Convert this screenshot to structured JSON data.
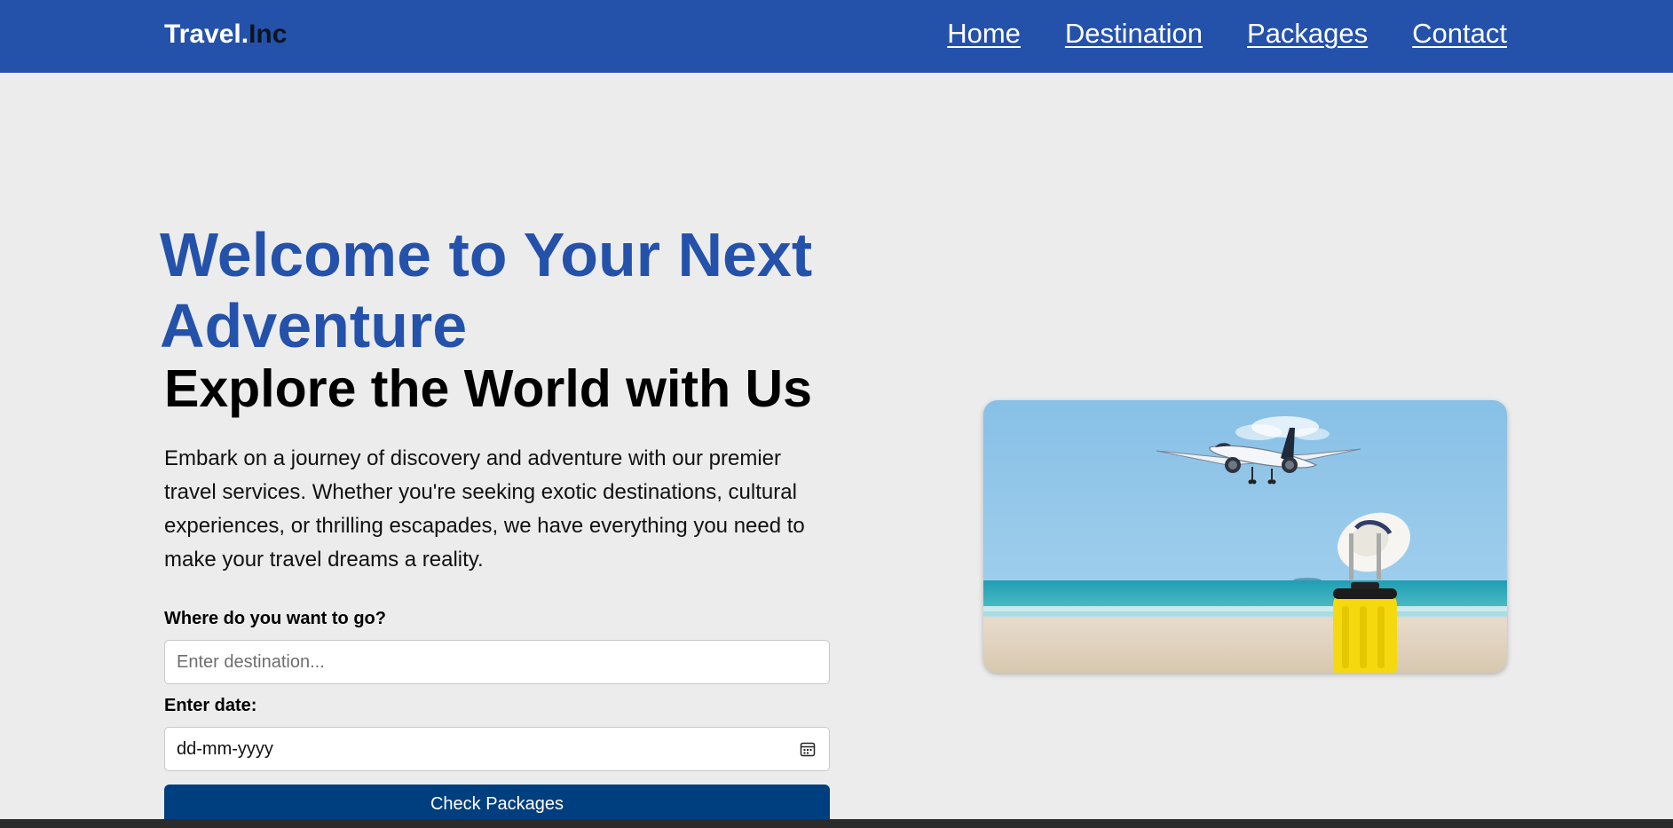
{
  "navbar": {
    "brand_part1": "Travel.",
    "brand_part2": "Inc",
    "links": [
      {
        "label": "Home"
      },
      {
        "label": "Destination"
      },
      {
        "label": "Packages"
      },
      {
        "label": "Contact"
      }
    ],
    "background_color": "#2452ab"
  },
  "hero": {
    "title": "Welcome to Your Next Adventure",
    "subtitle": "Explore the World with Us",
    "description": "Embark on a journey of discovery and adventure with our premier travel services. Whether you're seeking exotic destinations, cultural experiences, or thrilling escapades, we have everything you need to make your travel dreams a reality.",
    "title_color": "#2452ab"
  },
  "form": {
    "destination_label": "Where do you want to go?",
    "destination_placeholder": "Enter destination...",
    "destination_value": "",
    "date_label": "Enter date:",
    "date_placeholder": "dd-mm-yyyy",
    "submit_label": "Check Packages",
    "button_color": "#003f7f",
    "date_icon": "calendar-icon"
  },
  "image": {
    "icon": "airplane-beach-suitcase-photo"
  }
}
